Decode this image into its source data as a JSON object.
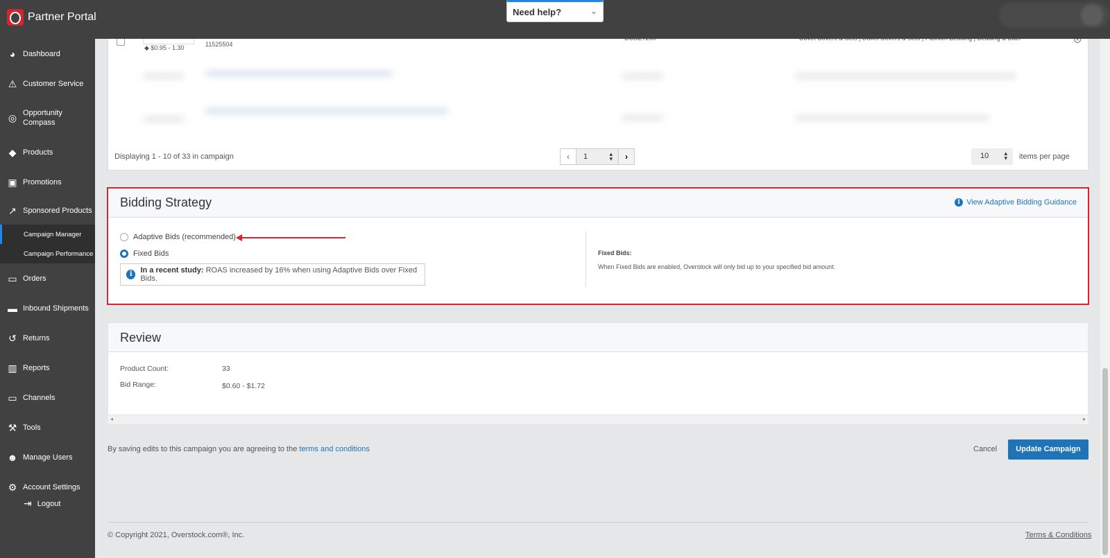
{
  "app": {
    "title": "Partner Portal"
  },
  "help": {
    "label": "Need help?"
  },
  "sidebar": {
    "items": [
      {
        "label": "Dashboard",
        "icon": "dashboard-icon"
      },
      {
        "label": "Customer Service",
        "icon": "warning-icon"
      },
      {
        "label": "Opportunity Compass",
        "icon": "compass-icon"
      },
      {
        "label": "Products",
        "icon": "tag-icon"
      },
      {
        "label": "Promotions",
        "icon": "money-icon"
      },
      {
        "label": "Sponsored Products",
        "icon": "chart-line-icon"
      },
      {
        "label": "Orders",
        "icon": "inbox-icon"
      },
      {
        "label": "Inbound Shipments",
        "icon": "truck-icon"
      },
      {
        "label": "Returns",
        "icon": "return-icon"
      },
      {
        "label": "Reports",
        "icon": "bar-chart-icon"
      },
      {
        "label": "Channels",
        "icon": "monitor-icon"
      },
      {
        "label": "Tools",
        "icon": "wrench-icon"
      },
      {
        "label": "Manage Users",
        "icon": "users-icon"
      },
      {
        "label": "Account Settings",
        "icon": "gear-icon"
      }
    ],
    "subitems": [
      {
        "label": "Campaign Manager",
        "active": true
      },
      {
        "label": "Campaign Performance",
        "active": false
      }
    ],
    "logout": "Logout"
  },
  "table": {
    "row": {
      "price": "$0.95 - 1.30",
      "sku": "11525504",
      "code": "DCSET200",
      "category": "Duvet Covers & Sets | Duvet Covers & Sets | Fashion Bedding | Bedding & Bath"
    },
    "pagination_text": "Displaying 1 - 10 of 33 in campaign",
    "page": "1",
    "items_per_page": "10",
    "items_per_page_label": "items per page"
  },
  "bidding": {
    "title": "Bidding Strategy",
    "guidance_link": "View Adaptive Bidding Guidance",
    "option_adaptive": "Adaptive Bids (recommended)",
    "option_fixed": "Fixed Bids",
    "selected": "Fixed Bids",
    "study_bold": "In a recent study:",
    "study_text": "ROAS increased by 16% when using Adaptive Bids over Fixed Bids.",
    "fixed_title": "Fixed Bids:",
    "fixed_desc": "When Fixed Bids are enabled, Overstock will only bid up to your specified bid amount."
  },
  "review": {
    "title": "Review",
    "product_count_label": "Product Count:",
    "product_count": "33",
    "bid_range_label": "Bid Range:",
    "bid_range": "$0.60 - $1.72"
  },
  "footer": {
    "agree_text": "By saving edits to this campaign you are agreeing to the",
    "terms_link": "terms and conditions",
    "cancel": "Cancel",
    "update": "Update Campaign",
    "copyright": "© Copyright 2021, Overstock.com®, Inc.",
    "terms": "Terms & Conditions"
  },
  "colors": {
    "accent": "#1f73b7",
    "highlight": "#d9232d",
    "sidebar": "#414141"
  }
}
